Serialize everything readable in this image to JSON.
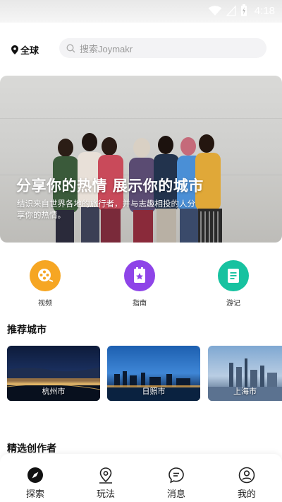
{
  "status_bar": {
    "time": "4:18",
    "icons": [
      "wifi-icon",
      "signal-icon",
      "battery-charging-icon"
    ]
  },
  "header": {
    "location_label": "全球",
    "search_placeholder": "搜索Joymakr"
  },
  "banner": {
    "title": "分享你的热情 展示你的城市",
    "subtitle": "结识来自世界各地的旅行者，并与志趣相投的人分享你的热情。"
  },
  "quick_nav": [
    {
      "label": "视频",
      "icon": "film-reel-icon",
      "color": "#f6a623"
    },
    {
      "label": "指南",
      "icon": "guide-book-icon",
      "color": "#8e44e8"
    },
    {
      "label": "游记",
      "icon": "travel-note-icon",
      "color": "#17c2a0"
    }
  ],
  "recommended": {
    "title": "推荐城市",
    "cities": [
      {
        "name": "杭州市"
      },
      {
        "name": "日照市"
      },
      {
        "name": "上海市"
      }
    ]
  },
  "creators": {
    "title": "精选创作者"
  },
  "tab_bar": [
    {
      "label": "探索",
      "icon": "compass-icon",
      "active": true
    },
    {
      "label": "玩法",
      "icon": "map-pin-icon",
      "active": false
    },
    {
      "label": "消息",
      "icon": "chat-bubble-icon",
      "active": false
    },
    {
      "label": "我的",
      "icon": "user-icon",
      "active": false
    }
  ]
}
